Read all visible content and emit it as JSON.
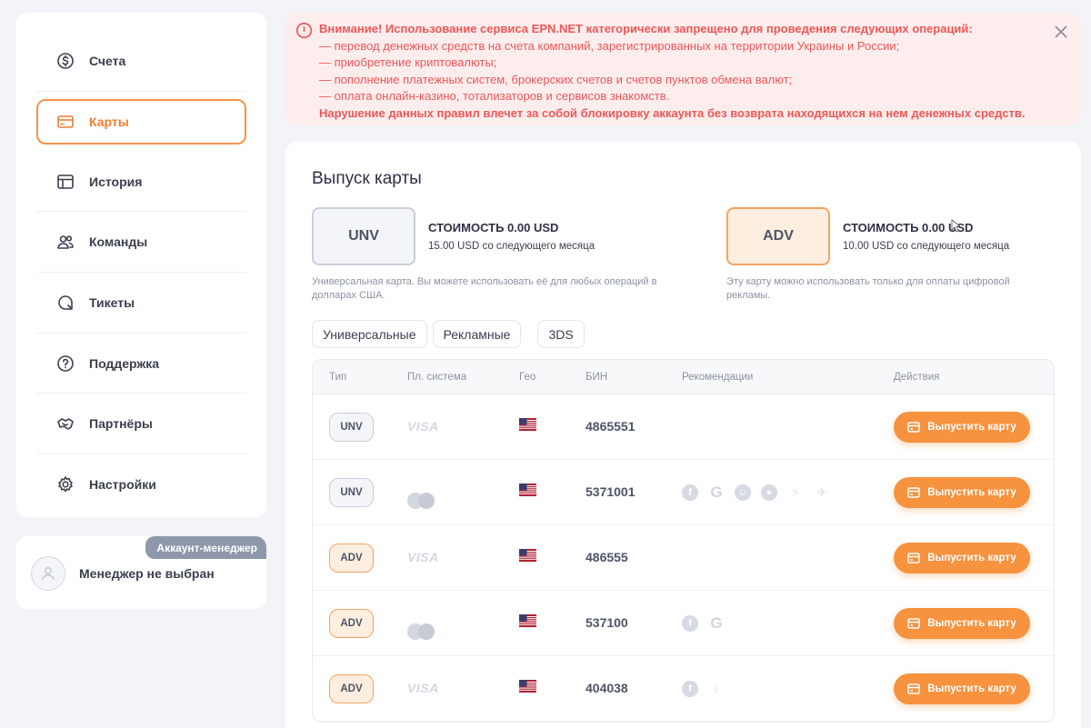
{
  "sidebar": {
    "items": [
      {
        "label": "Счета",
        "icon": "dollar-circle-icon"
      },
      {
        "label": "Карты",
        "icon": "card-icon",
        "active": true
      },
      {
        "label": "История",
        "icon": "history-icon"
      },
      {
        "label": "Команды",
        "icon": "team-icon"
      },
      {
        "label": "Тикеты",
        "icon": "ticket-icon"
      },
      {
        "label": "Поддержка",
        "icon": "help-icon"
      },
      {
        "label": "Партнёры",
        "icon": "handshake-icon"
      },
      {
        "label": "Настройки",
        "icon": "gear-icon"
      }
    ]
  },
  "manager": {
    "badge": "Аккаунт-менеджер",
    "name": "Менеджер не выбран"
  },
  "warning": {
    "title": "Внимание! Использование сервиса EPN.NET категорически запрещено для проведения следующих операций:",
    "lines": [
      "— перевод денежных средств на счета компаний, зарегистрированных на территории Украины и России;",
      "— приобретение криптовалюты;",
      "— пополнение платежных систем, брокерских счетов и счетов пунктов обмена валют;",
      "— оплата онлайн-казино, тотализаторов и сервисов знакомств."
    ],
    "footer": "Нарушение данных правил влечет за собой блокировку аккаунта без возврата находящихся на нем денежных средств."
  },
  "main": {
    "title": "Выпуск карты",
    "card_types": [
      {
        "code": "UNV",
        "price": "СТОИМОСТЬ 0.00 USD",
        "next": "15.00 USD со следующего месяца",
        "desc": "Универсальная карта. Вы можете использовать её для любых операций в долларах США."
      },
      {
        "code": "ADV",
        "price": "СТОИМОСТЬ 0.00 USD",
        "next": "10.00 USD со следующего месяца",
        "desc": "Эту карту можно использовать только для оплаты цифровой рекламы."
      }
    ],
    "filters": [
      "Универсальные",
      "Рекламные",
      "3DS"
    ],
    "table": {
      "headers": {
        "type": "Тип",
        "system": "Пл. система",
        "geo": "Гео",
        "bin": "БИН",
        "recs": "Рекомендации",
        "actions": "Действия"
      },
      "rows": [
        {
          "type": "UNV",
          "system": "VISA",
          "geo": "US",
          "bin": "4865551",
          "recs": [],
          "action": "Выпустить карту"
        },
        {
          "type": "UNV",
          "system": "mastercard",
          "geo": "US",
          "bin": "5371001",
          "recs": [
            "facebook-icon",
            "google-icon",
            "tiktok-face-icon",
            "reddit-icon",
            "bolt-icon",
            "plane-icon"
          ],
          "action": "Выпустить карту"
        },
        {
          "type": "ADV",
          "system": "VISA",
          "geo": "US",
          "bin": "486555",
          "recs": [],
          "action": "Выпустить карту"
        },
        {
          "type": "ADV",
          "system": "mastercard",
          "geo": "US",
          "bin": "537100",
          "recs": [
            "facebook-icon",
            "google-icon"
          ],
          "action": "Выпустить карту"
        },
        {
          "type": "ADV",
          "system": "VISA",
          "geo": "US",
          "bin": "404038",
          "recs": [
            "facebook-icon",
            "tiktok-icon"
          ],
          "action": "Выпустить карту"
        }
      ]
    }
  },
  "colors": {
    "accent": "#f7923e",
    "warning": "#ec5858",
    "warning_bg": "#fdeded"
  }
}
